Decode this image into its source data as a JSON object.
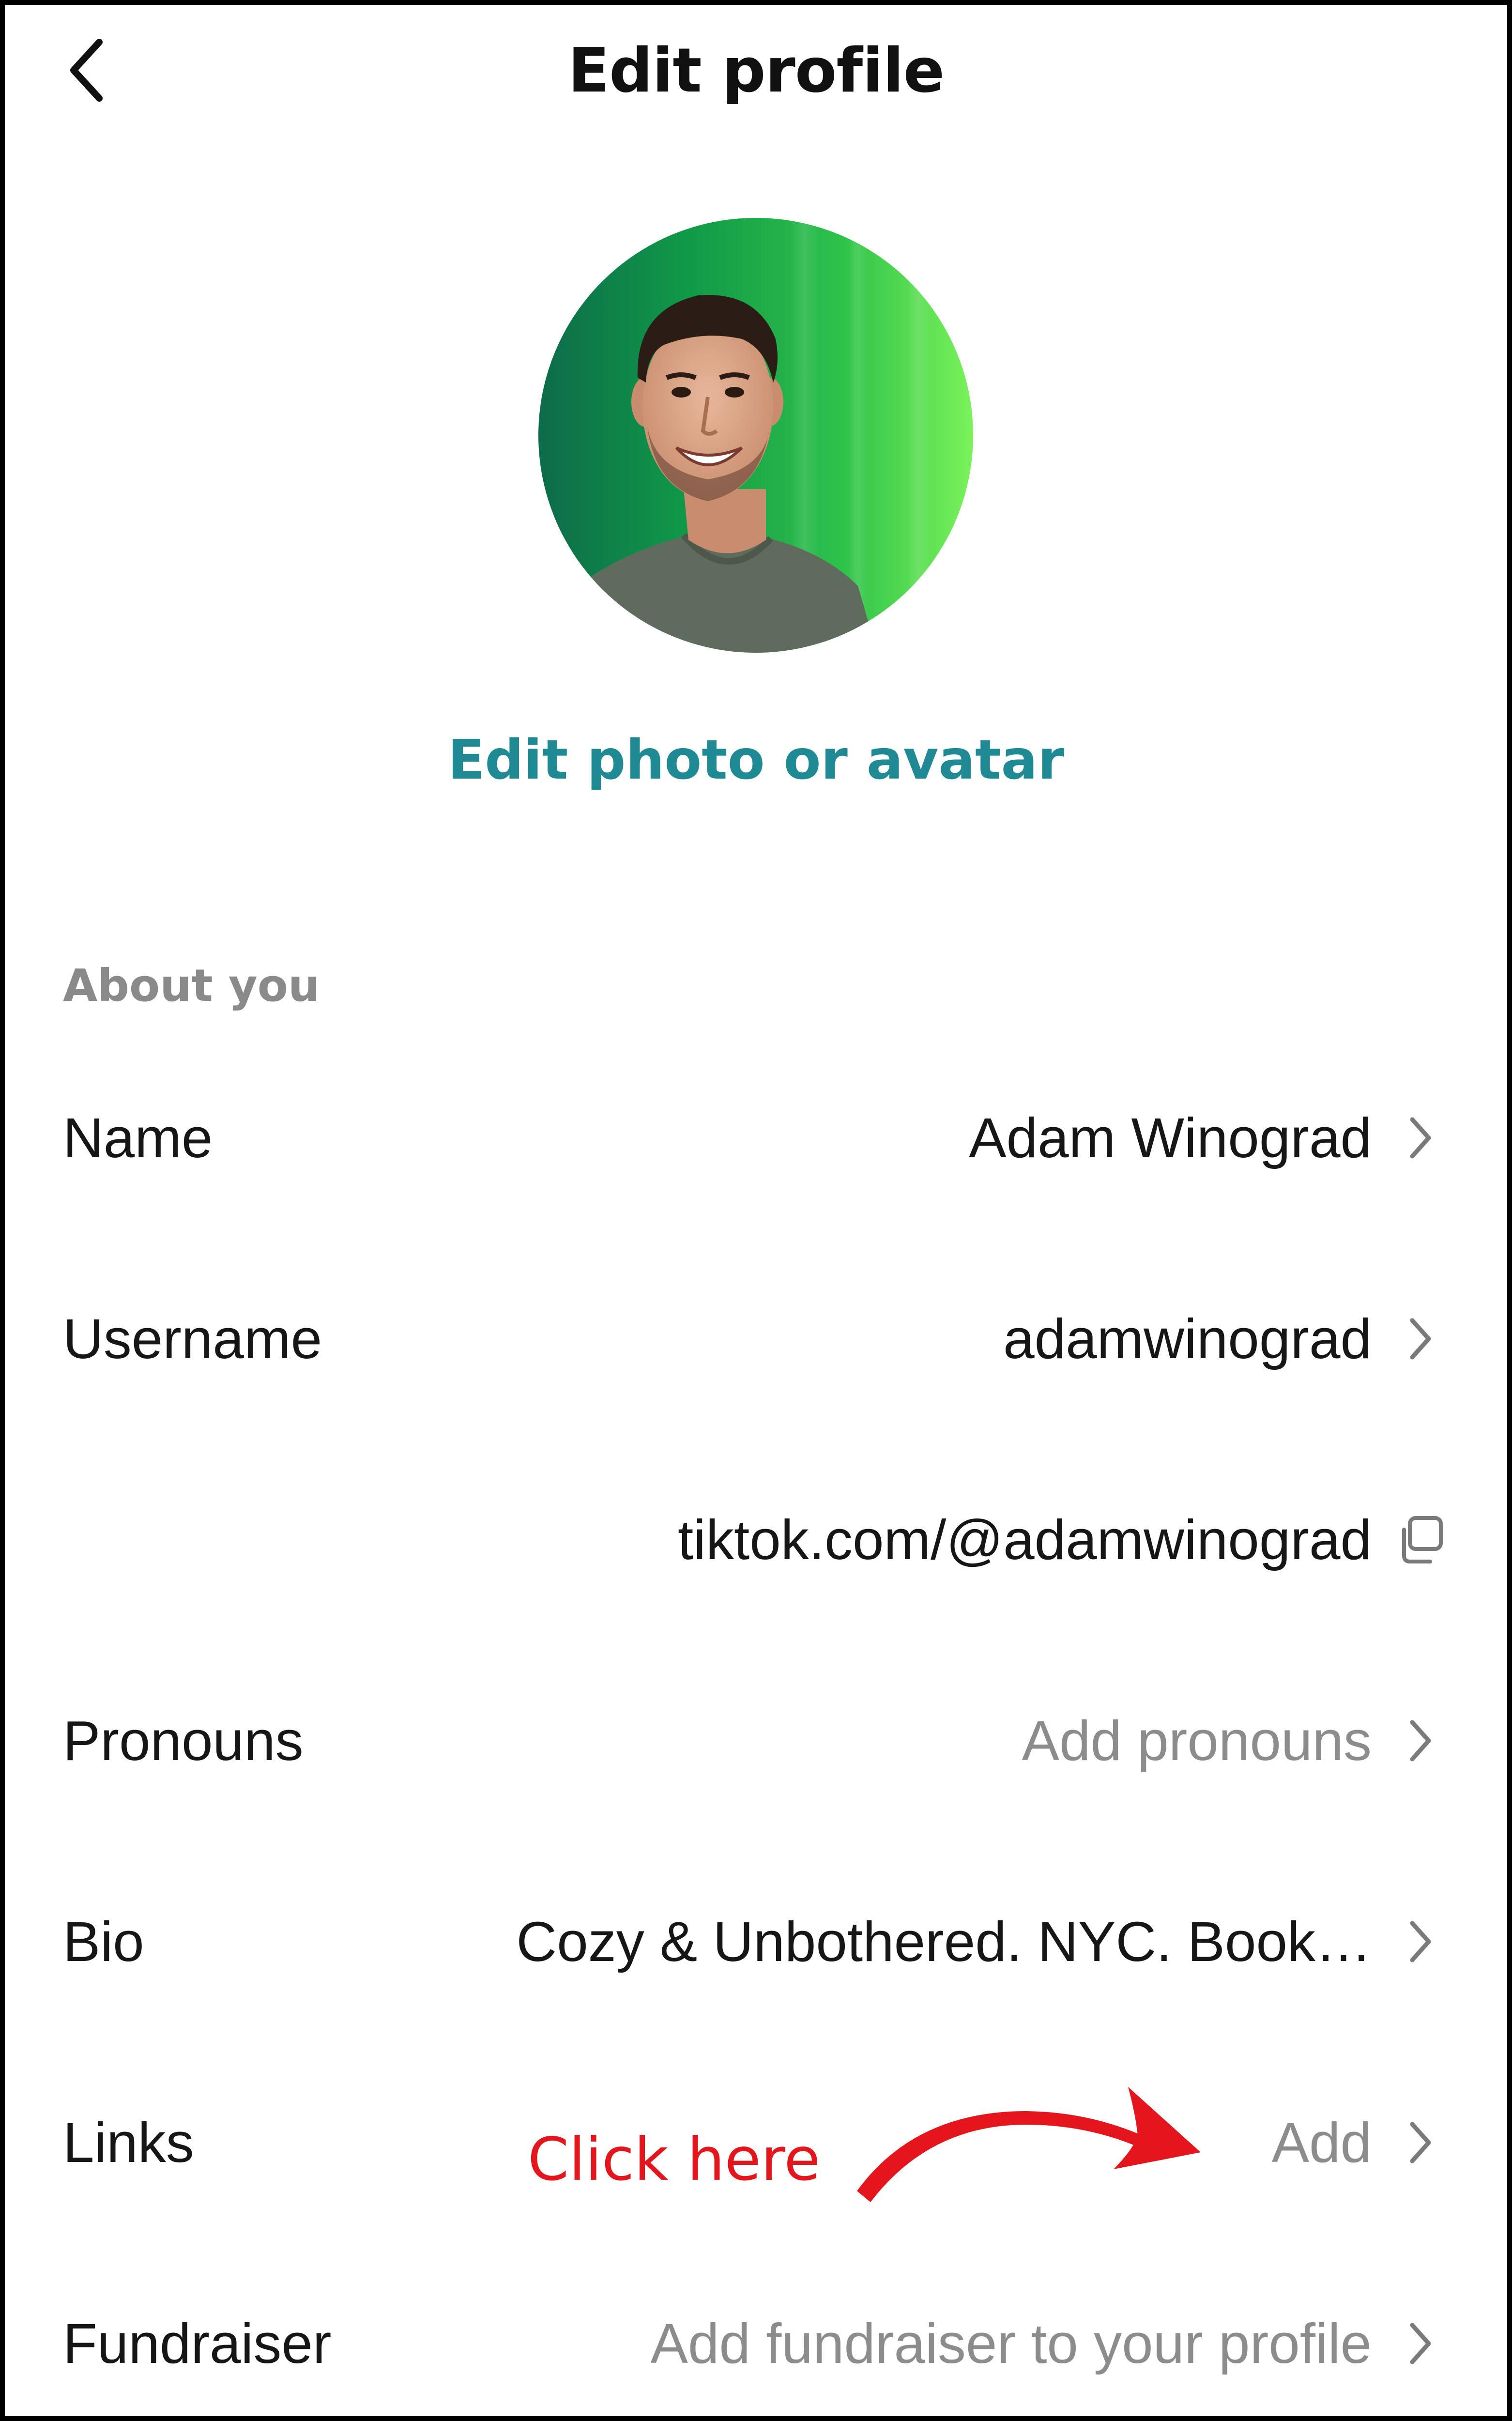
{
  "header": {
    "title": "Edit profile",
    "back_icon": "chevron-left-icon"
  },
  "profile": {
    "edit_photo_label": "Edit photo or avatar",
    "accent_color": "#1f8a94"
  },
  "section": {
    "label": "About you"
  },
  "rows": [
    {
      "label": "Name",
      "value": "Adam Winograd",
      "value_style": "normal",
      "icon": "chevron-right-icon"
    },
    {
      "label": "Username",
      "value": "adamwinograd",
      "value_style": "normal",
      "icon": "chevron-right-icon"
    },
    {
      "label": "",
      "value": "tiktok.com/@adamwinograd",
      "value_style": "normal",
      "icon": "copy-icon"
    },
    {
      "label": "Pronouns",
      "value": "Add pronouns",
      "value_style": "muted",
      "icon": "chevron-right-icon"
    },
    {
      "label": "Bio",
      "value": "Cozy & Unbothered. NYC. Book…",
      "value_style": "normal",
      "icon": "chevron-right-icon"
    },
    {
      "label": "Links",
      "value": "Add",
      "value_style": "muted",
      "icon": "chevron-right-icon"
    },
    {
      "label": "Fundraiser",
      "value": "Add fundraiser to your profile",
      "value_style": "muted",
      "icon": "chevron-right-icon"
    }
  ],
  "annotation": {
    "text": "Click here",
    "color": "#e3151d",
    "icon": "curved-arrow-icon"
  }
}
